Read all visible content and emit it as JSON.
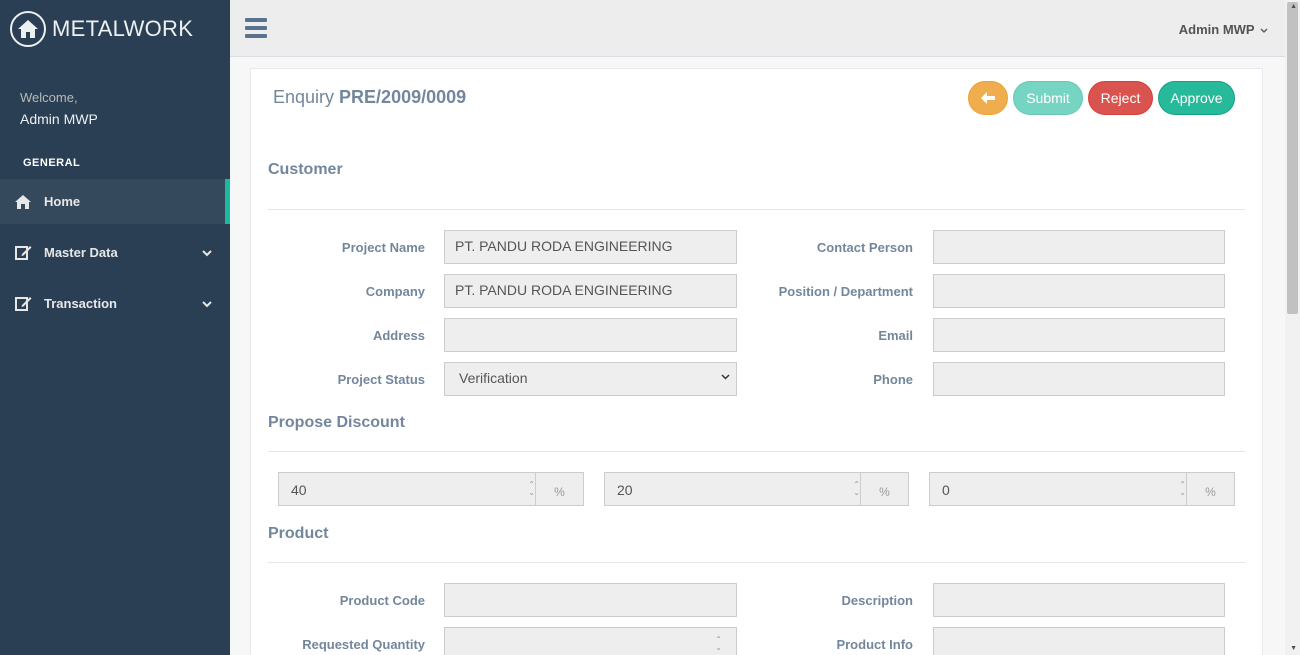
{
  "brand": {
    "title": "METALWORK",
    "icon": "home-icon"
  },
  "sidebar": {
    "welcome": "Welcome,",
    "user_name": "Admin MWP",
    "section_title": "GENERAL",
    "items": [
      {
        "label": "Home",
        "icon": "home-icon",
        "active": true
      },
      {
        "label": "Master Data",
        "icon": "edit-icon",
        "has_children": true
      },
      {
        "label": "Transaction",
        "icon": "edit-icon",
        "has_children": true
      }
    ]
  },
  "topbar": {
    "user_label": "Admin MWP"
  },
  "enquiry": {
    "title_prefix": "Enquiry",
    "number": "PRE/2009/0009",
    "buttons": {
      "back_icon": "arrow-left-icon",
      "submit": "Submit",
      "reject": "Reject",
      "approve": "Approve"
    },
    "colors": {
      "back": "#f0ad4e",
      "submit": "#76d4c2",
      "reject": "#d9534f",
      "approve": "#26b99a"
    }
  },
  "customer": {
    "heading": "Customer",
    "fields": {
      "project_name": {
        "label": "Project Name",
        "value": "PT. PANDU RODA ENGINEERING"
      },
      "company": {
        "label": "Company",
        "value": "PT. PANDU RODA ENGINEERING"
      },
      "address": {
        "label": "Address",
        "value": ""
      },
      "project_status": {
        "label": "Project Status",
        "value": "Verification"
      },
      "contact_person": {
        "label": "Contact Person",
        "value": ""
      },
      "position": {
        "label": "Position / Department",
        "value": ""
      },
      "email": {
        "label": "Email",
        "value": ""
      },
      "phone": {
        "label": "Phone",
        "value": ""
      }
    }
  },
  "discount": {
    "heading": "Propose Discount",
    "unit": "%",
    "values": [
      "40",
      "20",
      "0"
    ]
  },
  "product": {
    "heading": "Product",
    "fields": {
      "product_code": {
        "label": "Product Code",
        "value": ""
      },
      "requested_quantity": {
        "label": "Requested Quantity",
        "value": ""
      },
      "description": {
        "label": "Description",
        "value": ""
      },
      "product_info": {
        "label": "Product Info",
        "value": ""
      }
    }
  }
}
